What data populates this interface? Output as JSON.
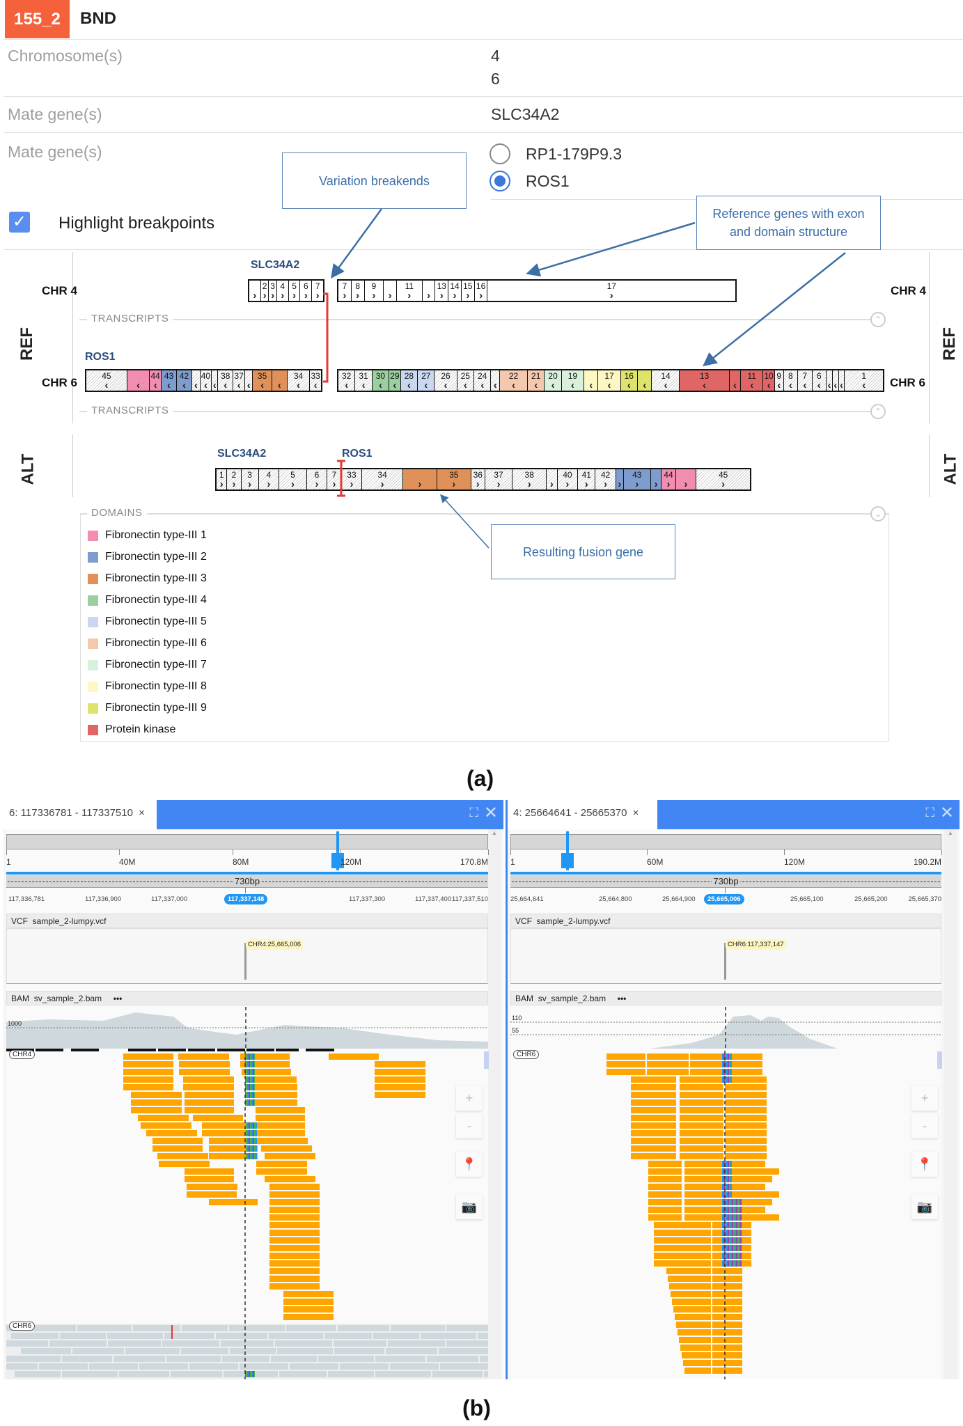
{
  "header": {
    "id": "155_2",
    "type": "BND",
    "badge_color": "#f4613b"
  },
  "rows": [
    {
      "label": "Chromosome(s)",
      "values": [
        "4",
        "6"
      ]
    },
    {
      "label": "Mate gene(s)",
      "value": "SLC34A2"
    },
    {
      "label": "Mate gene(s)",
      "options": [
        "RP1-179P9.3",
        "ROS1"
      ],
      "selected": "ROS1"
    }
  ],
  "highlight": {
    "label": "Highlight breakpoints",
    "checked": true
  },
  "callouts": {
    "breakends": "Variation breakends",
    "reference": "Reference genes with exon and domain structure",
    "fusion": "Resulting fusion gene"
  },
  "diagram": {
    "ref_label": "REF",
    "alt_label": "ALT",
    "chr4": "CHR 4",
    "chr6": "CHR 6",
    "transcripts": "TRANSCRIPTS",
    "domains_title": "DOMAINS",
    "gene_a": "SLC34A2",
    "gene_b": "ROS1",
    "boxes": {
      "chr4_left": {
        "exons": [
          "",
          "2",
          "3",
          "4",
          "5",
          "6",
          "7"
        ],
        "strand": "+"
      },
      "chr4_right": {
        "exons": [
          "7",
          "8",
          "9",
          "",
          "11",
          "",
          "13",
          "14",
          "15",
          "16",
          "17"
        ],
        "strand": "+"
      },
      "chr6_left": {
        "exons": [
          "45",
          "",
          "44",
          "43",
          "42",
          "",
          "40",
          "",
          "38",
          "37",
          "",
          "35",
          "",
          "34",
          "33"
        ],
        "domains": [
          null,
          0,
          0,
          1,
          1,
          null,
          null,
          null,
          null,
          null,
          null,
          2,
          2,
          null,
          null
        ],
        "strand": "-"
      },
      "chr6_right": {
        "exons": [
          "32",
          "31",
          "30",
          "29",
          "28",
          "27",
          "26",
          "25",
          "24",
          "",
          "22",
          "21",
          "20",
          "19",
          "",
          "17",
          "16",
          "",
          "14",
          "13",
          "",
          "11",
          "10",
          "9",
          "8",
          "7",
          "6",
          "",
          "",
          "",
          "1"
        ],
        "domains": [
          null,
          null,
          3,
          3,
          4,
          4,
          null,
          null,
          null,
          null,
          5,
          5,
          6,
          6,
          7,
          7,
          8,
          8,
          null,
          9,
          9,
          9,
          9,
          null,
          null,
          null,
          null,
          null,
          null,
          null,
          null
        ],
        "strand": "-"
      },
      "alt": {
        "exons": [
          "1",
          "2",
          "3",
          "4",
          "5",
          "6",
          "7",
          "33",
          "34",
          "",
          "35",
          "36",
          "37",
          "38",
          "",
          "40",
          "41",
          "42",
          "",
          "43",
          "",
          "44",
          "",
          "45"
        ],
        "domains": [
          null,
          null,
          null,
          null,
          null,
          null,
          null,
          null,
          null,
          2,
          2,
          null,
          null,
          null,
          null,
          null,
          null,
          null,
          1,
          1,
          1,
          0,
          0,
          null
        ],
        "strand": "+"
      }
    },
    "legend": [
      {
        "label": "Fibronectin type-III 1",
        "color": "#f28db2"
      },
      {
        "label": "Fibronectin type-III 2",
        "color": "#7f9ccf"
      },
      {
        "label": "Fibronectin type-III 3",
        "color": "#e0915a"
      },
      {
        "label": "Fibronectin type-III 4",
        "color": "#9ccf9f"
      },
      {
        "label": "Fibronectin type-III 5",
        "color": "#c9d8f0"
      },
      {
        "label": "Fibronectin type-III 6",
        "color": "#f4c8ae"
      },
      {
        "label": "Fibronectin type-III 7",
        "color": "#d9f0dd"
      },
      {
        "label": "Fibronectin type-III 8",
        "color": "#fdf7c3"
      },
      {
        "label": "Fibronectin type-III 9",
        "color": "#dde36b"
      },
      {
        "label": "Protein kinase",
        "color": "#e06666"
      }
    ]
  },
  "captions": {
    "a": "(a)",
    "b": "(b)"
  },
  "igv": [
    {
      "tab": "6: 117336781 - 117337510",
      "ideogram_ticks": [
        "1",
        "40M",
        "80M",
        "120M",
        "170.8M"
      ],
      "span": "730bp",
      "positions": [
        "117,336,781",
        "117,336,900",
        "117,337,000",
        "117,337,300",
        "117,337,400",
        "117,337,510"
      ],
      "center": "117,337,148",
      "vcf_label": "VCF",
      "vcf_file": "sample_2-lumpy.vcf",
      "vcf_tooltip": "CHR4:25,665,006",
      "bam_label": "BAM",
      "bam_file": "sv_sample_2.bam",
      "more": "•••",
      "coverage_ticks": [
        "1000"
      ],
      "chr_tags": [
        "CHR4",
        "CHR6"
      ]
    },
    {
      "tab": "4: 25664641 - 25665370",
      "ideogram_ticks": [
        "1",
        "60M",
        "120M",
        "190.2M"
      ],
      "span": "730bp",
      "positions": [
        "25,664,641",
        "25,664,800",
        "25,664,900",
        "25,665,100",
        "25,665,200",
        "25,665,370"
      ],
      "center": "25,665,006",
      "vcf_label": "VCF",
      "vcf_file": "sample_2-lumpy.vcf",
      "vcf_tooltip": "CHR6:117,337,147",
      "bam_label": "BAM",
      "bam_file": "sv_sample_2.bam",
      "more": "•••",
      "coverage_ticks": [
        "110",
        "55"
      ],
      "chr_tags": [
        "CHR6"
      ]
    }
  ],
  "tab_close": "×",
  "buttons": {
    "zoom_in": "+",
    "zoom_out": "-"
  },
  "colors": {
    "tab_blue": "#4286f4",
    "read": "#ffa500",
    "accent": "#2196f3",
    "breakpoint": "#e53935"
  }
}
